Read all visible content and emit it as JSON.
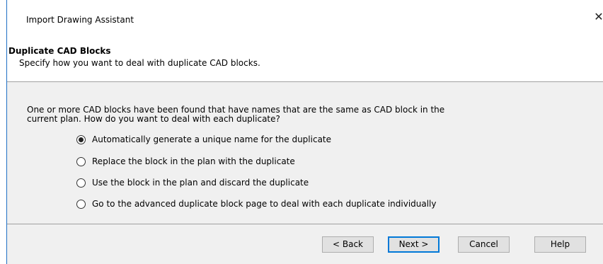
{
  "window": {
    "title": "Import Drawing Assistant",
    "close_glyph": "✕"
  },
  "header": {
    "title": "Duplicate CAD Blocks",
    "subtitle": "Specify how you want to deal with duplicate CAD blocks."
  },
  "question": "One or more CAD blocks have been found that have names that are the same as CAD block in the current plan. How do you want to deal with each duplicate?",
  "options": [
    {
      "label": "Automatically generate a unique name for the duplicate",
      "checked": true
    },
    {
      "label": "Replace the block in the plan with the duplicate",
      "checked": false
    },
    {
      "label": "Use the block in the plan and discard the duplicate",
      "checked": false
    },
    {
      "label": "Go to the advanced duplicate block page to deal with each duplicate individually",
      "checked": false
    }
  ],
  "buttons": {
    "back": "< Back",
    "next": "Next >",
    "cancel": "Cancel",
    "help": "Help"
  },
  "colors": {
    "accent": "#0078d7",
    "panel": "#f0f0f0",
    "window_border": "#1f6fc5"
  }
}
